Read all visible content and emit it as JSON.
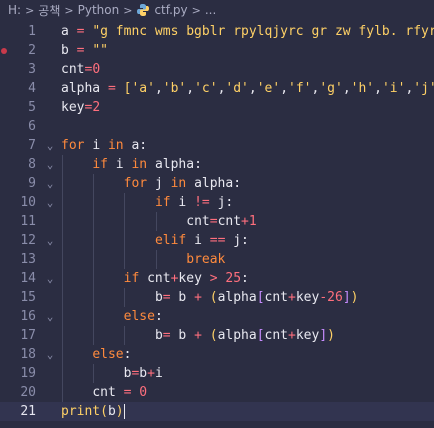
{
  "breadcrumb": {
    "items": [
      "H:",
      "공책",
      "Python",
      "ctf.py",
      "..."
    ],
    "separator": ">"
  },
  "editor": {
    "active_line": 21,
    "breakpoint_line": 2,
    "lines": [
      {
        "n": "1",
        "text": "a = \"g fmnc wms bgblr rpylqjyrc gr zw fylb. rfyrq"
      },
      {
        "n": "2",
        "text": "b = \"\""
      },
      {
        "n": "3",
        "text": "cnt=0"
      },
      {
        "n": "4",
        "text": "alpha = ['a','b','c','d','e','f','g','h','i','j',"
      },
      {
        "n": "5",
        "text": "key=2"
      },
      {
        "n": "6",
        "text": ""
      },
      {
        "n": "7",
        "text": "for i in a:"
      },
      {
        "n": "8",
        "text": "    if i in alpha:"
      },
      {
        "n": "9",
        "text": "        for j in alpha:"
      },
      {
        "n": "10",
        "text": "            if i != j:"
      },
      {
        "n": "11",
        "text": "                cnt=cnt+1"
      },
      {
        "n": "12",
        "text": "            elif i == j:"
      },
      {
        "n": "13",
        "text": "                break"
      },
      {
        "n": "14",
        "text": "        if cnt+key > 25:"
      },
      {
        "n": "15",
        "text": "            b= b + (alpha[cnt+key-26])"
      },
      {
        "n": "16",
        "text": "        else:"
      },
      {
        "n": "17",
        "text": "            b= b + (alpha[cnt+key])"
      },
      {
        "n": "18",
        "text": "    else:"
      },
      {
        "n": "19",
        "text": "        b=b+i"
      },
      {
        "n": "20",
        "text": "    cnt = 0"
      },
      {
        "n": "21",
        "text": "print(b)"
      }
    ],
    "fold_lines": [
      "7",
      "8",
      "9",
      "10",
      "12",
      "14",
      "16",
      "18"
    ]
  },
  "colors": {
    "background": "#2b2d42",
    "keyword": "#ff8a3d",
    "string": "#ffd166",
    "number": "#ff6f7d",
    "text": "#e8e8f0",
    "line_number": "#8a8daa",
    "breakpoint": "#c83a4b"
  },
  "icons": {
    "file": "python-file-icon",
    "fold": "chevron-down-icon",
    "separator": "chevron-right-icon"
  }
}
